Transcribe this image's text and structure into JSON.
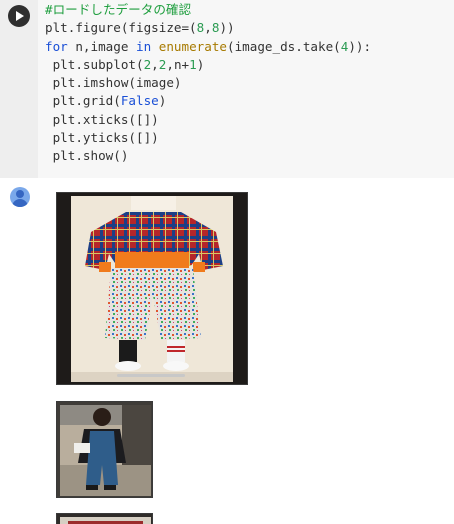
{
  "cell": {
    "run_button_icon": "play-icon",
    "code_lines": [
      [
        {
          "t": "#ロードしたデータの確認",
          "c": "comment"
        }
      ],
      [
        {
          "t": "plt.figure(figsize=(",
          "c": "plain"
        },
        {
          "t": "8",
          "c": "number"
        },
        {
          "t": ",",
          "c": "plain"
        },
        {
          "t": "8",
          "c": "number"
        },
        {
          "t": "))",
          "c": "plain"
        }
      ],
      [
        {
          "t": "for",
          "c": "keyword"
        },
        {
          "t": " n,image ",
          "c": "plain"
        },
        {
          "t": "in",
          "c": "keyword"
        },
        {
          "t": " ",
          "c": "plain"
        },
        {
          "t": "enumerate",
          "c": "builtin"
        },
        {
          "t": "(image_ds.take(",
          "c": "plain"
        },
        {
          "t": "4",
          "c": "number"
        },
        {
          "t": ")):",
          "c": "plain"
        }
      ],
      [
        {
          "t": " plt.subplot(",
          "c": "plain"
        },
        {
          "t": "2",
          "c": "number"
        },
        {
          "t": ",",
          "c": "plain"
        },
        {
          "t": "2",
          "c": "number"
        },
        {
          "t": ",n+",
          "c": "plain"
        },
        {
          "t": "1",
          "c": "number"
        },
        {
          "t": ")",
          "c": "plain"
        }
      ],
      [
        {
          "t": " plt.imshow(image)",
          "c": "plain"
        }
      ],
      [
        {
          "t": " plt.grid(",
          "c": "plain"
        },
        {
          "t": "False",
          "c": "const"
        },
        {
          "t": ")",
          "c": "plain"
        }
      ],
      [
        {
          "t": " plt.xticks([])",
          "c": "plain"
        }
      ],
      [
        {
          "t": " plt.yticks([])",
          "c": "plain"
        }
      ],
      [
        {
          "t": " plt.show()",
          "c": "plain"
        }
      ]
    ]
  },
  "output": {
    "output_icon": "user-avatar-icon"
  }
}
